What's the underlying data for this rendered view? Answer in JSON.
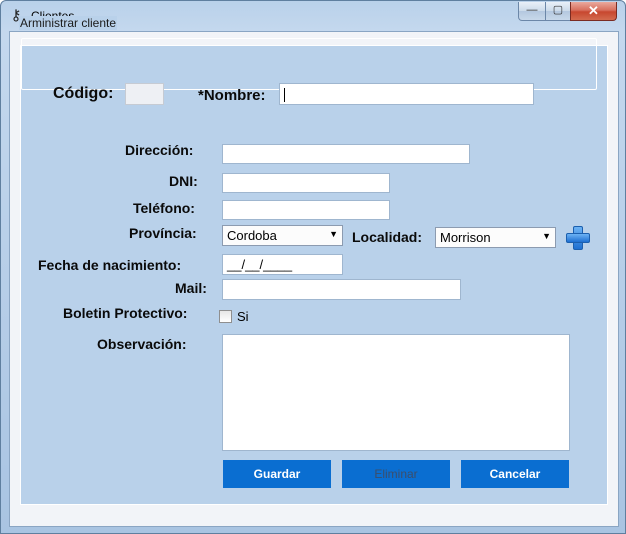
{
  "window": {
    "title": "Clientes",
    "minimize": "—",
    "maximize": "▢",
    "close": "✕"
  },
  "group": {
    "label": "Arministrar cliente"
  },
  "fields": {
    "codigo_label": "Código:",
    "codigo_value": "",
    "nombre_label": "*Nombre:",
    "nombre_value": "",
    "direccion_label": "Dirección:",
    "direccion_value": "",
    "dni_label": "DNI:",
    "dni_value": "",
    "telefono_label": "Teléfono:",
    "telefono_value": "",
    "provincia_label": "Província:",
    "provincia_value": "Cordoba",
    "localidad_label": "Localidad:",
    "localidad_value": "Morrison",
    "fecha_label": "Fecha de nacimiento:",
    "fecha_value": "__/__/____",
    "mail_label": "Mail:",
    "mail_value": "",
    "boletin_label": "Boletin Protectivo:",
    "boletin_checkbox_label": "Si",
    "boletin_checked": false,
    "observacion_label": "Observación:",
    "observacion_value": ""
  },
  "buttons": {
    "guardar": "Guardar",
    "eliminar": "Eliminar",
    "cancelar": "Cancelar"
  },
  "icons": {
    "app": "key-icon",
    "add_localidad": "plus-icon"
  }
}
